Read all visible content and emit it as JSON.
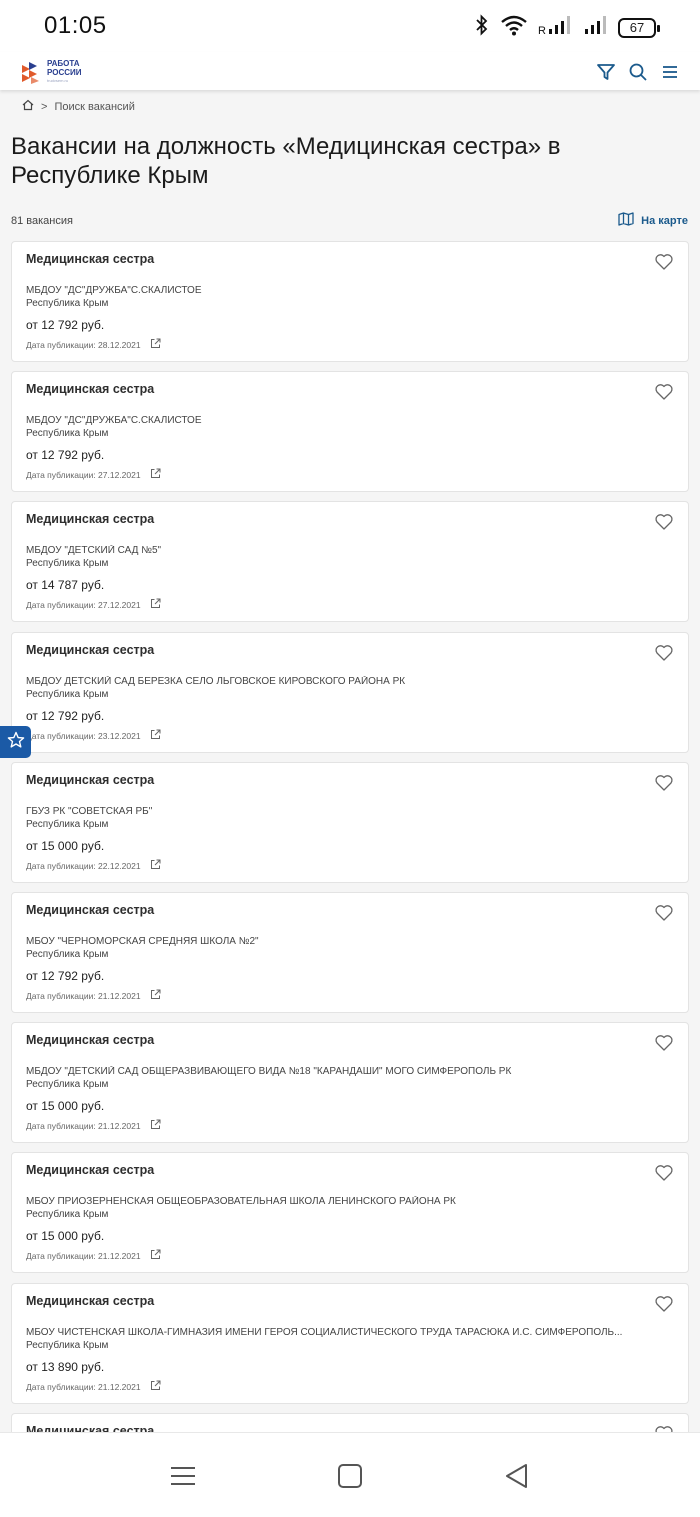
{
  "status_bar": {
    "time": "01:05",
    "battery": "67",
    "icons": [
      "bluetooth-icon",
      "wifi-icon",
      "signal-r-icon",
      "signal-icon",
      "battery-icon"
    ]
  },
  "header": {
    "logo_line1": "РАБОТА",
    "logo_line2": "РОССИИ",
    "logo_sub": "trudvsem.ru",
    "icons": [
      "filter-icon",
      "search-icon",
      "menu-icon"
    ],
    "accent_color": "#1b5a8c"
  },
  "breadcrumb": {
    "home_icon": "home-icon",
    "separator": ">",
    "current": "Поиск вакансий"
  },
  "page": {
    "title": "Вакансии на должность «Медицинская сестра» в Республике Крым",
    "count": "81 вакансия",
    "map_link": "На карте"
  },
  "vacancies": [
    {
      "title": "Медицинская сестра",
      "company": "МБДОУ \"ДС\"ДРУЖБА\"С.СКАЛИСТОЕ",
      "region": "Республика Крым",
      "salary": "от 12 792 руб.",
      "date": "Дата публикации: 28.12.2021"
    },
    {
      "title": "Медицинская сестра",
      "company": "МБДОУ \"ДС\"ДРУЖБА\"С.СКАЛИСТОЕ",
      "region": "Республика Крым",
      "salary": "от 12 792 руб.",
      "date": "Дата публикации: 27.12.2021"
    },
    {
      "title": "Медицинская сестра",
      "company": "МБДОУ \"ДЕТСКИЙ САД №5\"",
      "region": "Республика Крым",
      "salary": "от 14 787 руб.",
      "date": "Дата публикации: 27.12.2021"
    },
    {
      "title": "Медицинская сестра",
      "company": "МБДОУ ДЕТСКИЙ САД БЕРЕЗКА СЕЛО ЛЬГОВСКОЕ КИРОВСКОГО РАЙОНА РК",
      "region": "Республика Крым",
      "salary": "от 12 792 руб.",
      "date": "Дата публикации: 23.12.2021"
    },
    {
      "title": "Медицинская сестра",
      "company": "ГБУЗ РК \"СОВЕТСКАЯ РБ\"",
      "region": "Республика Крым",
      "salary": "от 15 000 руб.",
      "date": "Дата публикации: 22.12.2021"
    },
    {
      "title": "Медицинская сестра",
      "company": "МБОУ \"ЧЕРНОМОРСКАЯ СРЕДНЯЯ ШКОЛА №2\"",
      "region": "Республика Крым",
      "salary": "от 12 792 руб.",
      "date": "Дата публикации: 21.12.2021"
    },
    {
      "title": "Медицинская сестра",
      "company": "МБДОУ \"ДЕТСКИЙ САД ОБЩЕРАЗВИВАЮЩЕГО ВИДА №18 \"КАРАНДАШИ\" МОГО СИМФЕРОПОЛЬ РК",
      "region": "Республика Крым",
      "salary": "от 15 000 руб.",
      "date": "Дата публикации: 21.12.2021"
    },
    {
      "title": "Медицинская сестра",
      "company": "МБОУ ПРИОЗЕРНЕНСКАЯ ОБЩЕОБРАЗОВАТЕЛЬНАЯ ШКОЛА ЛЕНИНСКОГО РАЙОНА РК",
      "region": "Республика Крым",
      "salary": "от 15 000 руб.",
      "date": "Дата публикации: 21.12.2021"
    },
    {
      "title": "Медицинская сестра",
      "company": "МБОУ ЧИСТЕНСКАЯ ШКОЛА-ГИМНАЗИЯ ИМЕНИ ГЕРОЯ СОЦИАЛИСТИЧЕСКОГО ТРУДА ТАРАСЮКА И.С. СИМФЕРОПОЛЬ...",
      "region": "Республика Крым",
      "salary": "от 13 890 руб.",
      "date": "Дата публикации: 21.12.2021"
    }
  ],
  "partial_vacancy": {
    "title": "Медицинская сестра"
  },
  "nav_bar": {
    "icons": [
      "recent-apps-icon",
      "home-button-icon",
      "back-icon"
    ]
  }
}
